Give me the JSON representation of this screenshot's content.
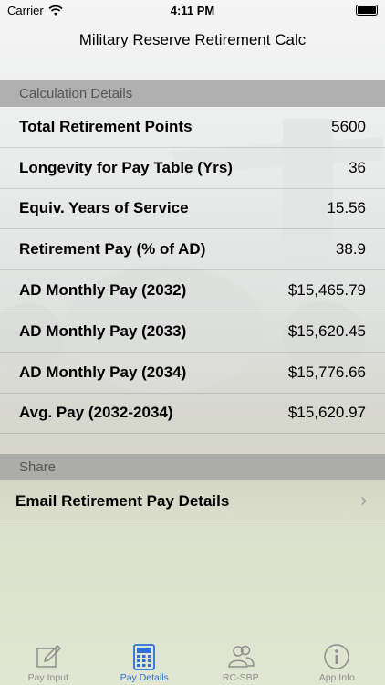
{
  "status": {
    "carrier": "Carrier",
    "time": "4:11 PM"
  },
  "nav": {
    "title": "Military Reserve Retirement Calc"
  },
  "sections": {
    "details_header": "Calculation Details",
    "share_header": "Share"
  },
  "rows": [
    {
      "label": "Total Retirement Points",
      "value": "5600"
    },
    {
      "label": "Longevity for Pay Table (Yrs)",
      "value": "36"
    },
    {
      "label": "Equiv. Years of Service",
      "value": "15.56"
    },
    {
      "label": "Retirement Pay (% of AD)",
      "value": "38.9"
    },
    {
      "label": "AD Monthly Pay (2032)",
      "value": "$15,465.79"
    },
    {
      "label": "AD Monthly Pay (2033)",
      "value": "$15,620.45"
    },
    {
      "label": "AD Monthly Pay (2034)",
      "value": "$15,776.66"
    },
    {
      "label": "Avg. Pay (2032-2034)",
      "value": "$15,620.97"
    }
  ],
  "share": {
    "email_label": "Email Retirement Pay Details"
  },
  "tabs": [
    {
      "label": "Pay Input",
      "icon": "pencil-square-icon",
      "active": false
    },
    {
      "label": "Pay Details",
      "icon": "calculator-icon",
      "active": true
    },
    {
      "label": "RC-SBP",
      "icon": "people-icon",
      "active": false
    },
    {
      "label": "App Info",
      "icon": "info-icon",
      "active": false
    }
  ],
  "colors": {
    "accent": "#2f6fd6",
    "inactive_tab": "#8e8e8e",
    "section_header_bg": "#a5a5a5"
  }
}
